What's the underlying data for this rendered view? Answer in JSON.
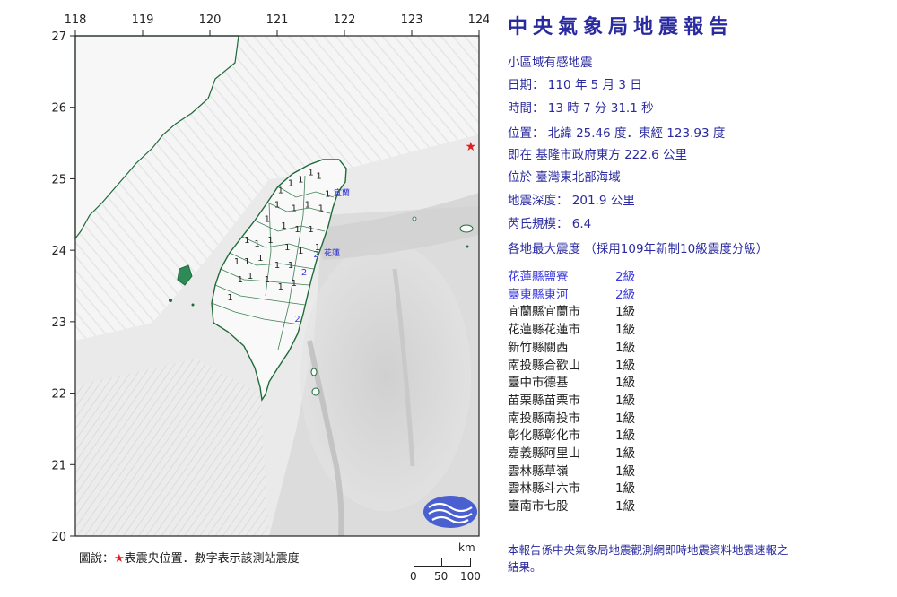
{
  "report": {
    "title": "中央氣象局地震報告",
    "subtitle": "小區域有感地震",
    "date": "日期： 110 年 5 月 3 日",
    "time": "時間： 13 時 7 分 31.1 秒",
    "position": "位置： 北緯 25.46 度．東經 123.93 度",
    "relative": "即在 基隆市政府東方 222.6 公里",
    "region": "位於 臺灣東北部海域",
    "depth": "地震深度： 201.9 公里",
    "magnitude": "芮氏規模： 6.4",
    "intensity_heading": "各地最大震度 （採用109年新制10級震度分級）",
    "footnote": "本報告係中央氣象局地震觀測網即時地震資料地震速報之結果。"
  },
  "stations": [
    {
      "name": "花蓮縣鹽寮",
      "level": "2級"
    },
    {
      "name": "臺東縣東河",
      "level": "2級"
    },
    {
      "name": "宜蘭縣宜蘭市",
      "level": "1級"
    },
    {
      "name": "花蓮縣花蓮市",
      "level": "1級"
    },
    {
      "name": "新竹縣關西",
      "level": "1級"
    },
    {
      "name": "南投縣合歡山",
      "level": "1級"
    },
    {
      "name": "臺中市德基",
      "level": "1級"
    },
    {
      "name": "苗栗縣苗栗市",
      "level": "1級"
    },
    {
      "name": "南投縣南投市",
      "level": "1級"
    },
    {
      "name": "彰化縣彰化市",
      "level": "1級"
    },
    {
      "name": "嘉義縣阿里山",
      "level": "1級"
    },
    {
      "name": "雲林縣草嶺",
      "level": "1級"
    },
    {
      "name": "雲林縣斗六市",
      "level": "1級"
    },
    {
      "name": "臺南市七股",
      "level": "1級"
    }
  ],
  "map": {
    "lon_ticks": [
      "118",
      "119",
      "120",
      "121",
      "122",
      "123",
      "124"
    ],
    "lat_ticks": [
      "27",
      "26",
      "25",
      "24",
      "23",
      "22",
      "21",
      "20"
    ],
    "legend": {
      "prefix": "圖說：",
      "star": "★",
      "text": "表震央位置．數字表示該測站震度"
    },
    "scale": {
      "unit": "km",
      "labels": [
        "0",
        "50",
        "100"
      ]
    },
    "city_labels": {
      "yilan": "宜蘭",
      "hualien": "花蓮"
    },
    "epicenter": {
      "lon": 123.93,
      "lat": 25.46
    },
    "station_marks": [
      {
        "lon": 121.75,
        "lat": 24.75,
        "v": "1"
      },
      {
        "lon": 121.6,
        "lat": 24.0,
        "v": "1"
      },
      {
        "lon": 121.58,
        "lat": 23.9,
        "v": "2"
      },
      {
        "lon": 121.4,
        "lat": 23.65,
        "v": "2"
      },
      {
        "lon": 121.3,
        "lat": 23.0,
        "v": "2"
      },
      {
        "lon": 121.05,
        "lat": 24.8,
        "v": "1"
      },
      {
        "lon": 121.2,
        "lat": 24.9,
        "v": "1"
      },
      {
        "lon": 121.35,
        "lat": 24.95,
        "v": "1"
      },
      {
        "lon": 121.5,
        "lat": 25.05,
        "v": "1"
      },
      {
        "lon": 121.62,
        "lat": 25.0,
        "v": "1"
      },
      {
        "lon": 121.0,
        "lat": 24.6,
        "v": "1"
      },
      {
        "lon": 121.25,
        "lat": 24.55,
        "v": "1"
      },
      {
        "lon": 121.45,
        "lat": 24.6,
        "v": "1"
      },
      {
        "lon": 121.65,
        "lat": 24.55,
        "v": "1"
      },
      {
        "lon": 120.85,
        "lat": 24.4,
        "v": "1"
      },
      {
        "lon": 121.1,
        "lat": 24.3,
        "v": "1"
      },
      {
        "lon": 121.3,
        "lat": 24.25,
        "v": "1"
      },
      {
        "lon": 121.5,
        "lat": 24.25,
        "v": "1"
      },
      {
        "lon": 120.55,
        "lat": 24.1,
        "v": "1"
      },
      {
        "lon": 120.7,
        "lat": 24.05,
        "v": "1"
      },
      {
        "lon": 120.9,
        "lat": 24.1,
        "v": "1"
      },
      {
        "lon": 121.15,
        "lat": 24.0,
        "v": "1"
      },
      {
        "lon": 121.35,
        "lat": 23.95,
        "v": "1"
      },
      {
        "lon": 120.4,
        "lat": 23.8,
        "v": "1"
      },
      {
        "lon": 120.55,
        "lat": 23.8,
        "v": "1"
      },
      {
        "lon": 120.75,
        "lat": 23.85,
        "v": "1"
      },
      {
        "lon": 121.0,
        "lat": 23.75,
        "v": "1"
      },
      {
        "lon": 121.2,
        "lat": 23.75,
        "v": "1"
      },
      {
        "lon": 120.45,
        "lat": 23.55,
        "v": "1"
      },
      {
        "lon": 120.6,
        "lat": 23.6,
        "v": "1"
      },
      {
        "lon": 120.85,
        "lat": 23.55,
        "v": "1"
      },
      {
        "lon": 121.05,
        "lat": 23.45,
        "v": "1"
      },
      {
        "lon": 120.3,
        "lat": 23.3,
        "v": "1"
      },
      {
        "lon": 121.25,
        "lat": 23.5,
        "v": "1"
      }
    ]
  }
}
